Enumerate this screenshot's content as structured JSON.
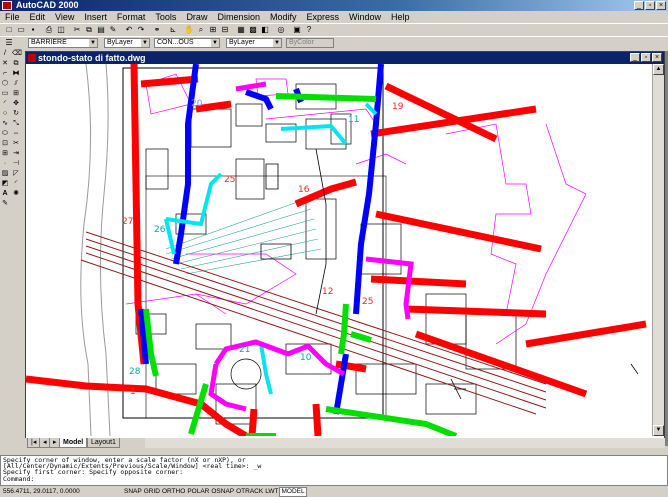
{
  "window": {
    "title": "AutoCAD 2000"
  },
  "menu": [
    "File",
    "Edit",
    "View",
    "Insert",
    "Format",
    "Tools",
    "Draw",
    "Dimension",
    "Modify",
    "Express",
    "Window",
    "Help"
  ],
  "properties": {
    "layer": "BARRIERE",
    "color": "ByLayer",
    "linetype": "CON...OUS",
    "lineweight": "ByLayer",
    "plotstyle": "ByColor"
  },
  "drawing": {
    "title": "stondo-stato di fatto.dwg",
    "labels": [
      "26",
      "25",
      "20",
      "16",
      "28",
      "21",
      "11",
      "10",
      "19",
      "1",
      "25",
      "12",
      "27"
    ]
  },
  "tabs": [
    "Model",
    "Layout1"
  ],
  "command_history": [
    "Specify corner of window, enter a scale factor (nX or nXP), or",
    "[All/Center/Dynamic/Extents/Previous/Scale/Window] <real time>: _w",
    "Specify first corner: Specify opposite corner:",
    "Command:"
  ],
  "status": {
    "coords": "556.4711, 29.0117, 0.0000",
    "toggles": [
      "SNAP",
      "GRID",
      "ORTHO",
      "POLAR",
      "OSNAP",
      "OTRACK",
      "LWT",
      "MODEL"
    ]
  },
  "colors": {
    "title_blue": "#0a246a",
    "red": "#ff0000",
    "blue": "#0000ff",
    "green": "#00ff00",
    "cyan": "#00ffff",
    "magenta": "#ff00ff"
  }
}
